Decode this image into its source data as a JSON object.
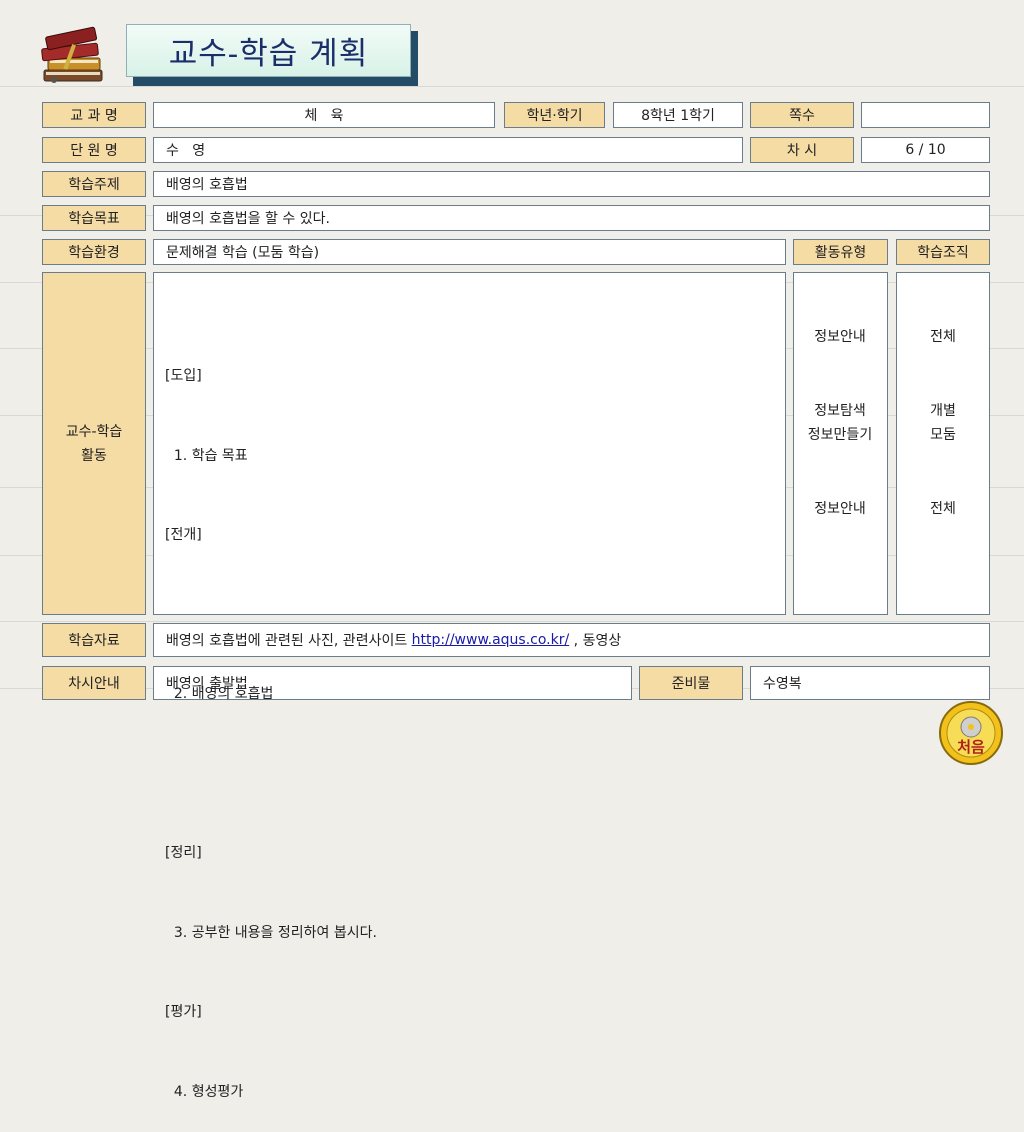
{
  "title": "교수-학습 계획",
  "rows": {
    "subject": {
      "label": "교 과 명",
      "value": "체   육"
    },
    "grade_term": {
      "label": "학년·학기",
      "value": "8학년 1학기"
    },
    "page": {
      "label": "쪽수",
      "value": ""
    },
    "unit": {
      "label": "단 원 명",
      "value": "수   영"
    },
    "session": {
      "label": "차 시",
      "value": "6 / 10"
    },
    "topic": {
      "label": "학습주제",
      "value": "배영의 호흡법"
    },
    "goal": {
      "label": "학습목표",
      "value": "배영의 호흡법을 할 수 있다."
    },
    "environment": {
      "label": "학습환경",
      "value": "문제해결 학습 (모둠 학습)"
    },
    "activity_type_label": "활동유형",
    "organization_label": "학습조직",
    "activity": {
      "label_line1": "교수-학습",
      "label_line2": "활동",
      "lines": [
        "[도입]",
        "  1. 학습 목표",
        "[전개]",
        "",
        "  2. 배영의 호흡법",
        "",
        "[정리]",
        "  3. 공부한 내용을 정리하여 봅시다.",
        "[평가]",
        "  4. 형성평가"
      ],
      "types": [
        "정보안내",
        "",
        "",
        "정보탐색",
        "정보만들기",
        "",
        "",
        "정보안내"
      ],
      "orgs": [
        "전체",
        "",
        "",
        "개별",
        "모둠",
        "",
        "",
        "전체"
      ]
    },
    "materials": {
      "label": "학습자료",
      "text_before": "배영의 호흡법에 관련된 사진, 관련사이트 ",
      "link": "http://www.aqus.co.kr/",
      "text_after": " , 동영상"
    },
    "next": {
      "label": "차시안내",
      "value": "배영의 출발법"
    },
    "prep": {
      "label": "준비물",
      "value": "수영복"
    }
  },
  "home_button": {
    "label": "처음",
    "icon": "home-cd-icon"
  },
  "colors": {
    "label_bg": "#f5dca4",
    "title_text": "#1a2e6a",
    "border": "#6a7d8c"
  }
}
